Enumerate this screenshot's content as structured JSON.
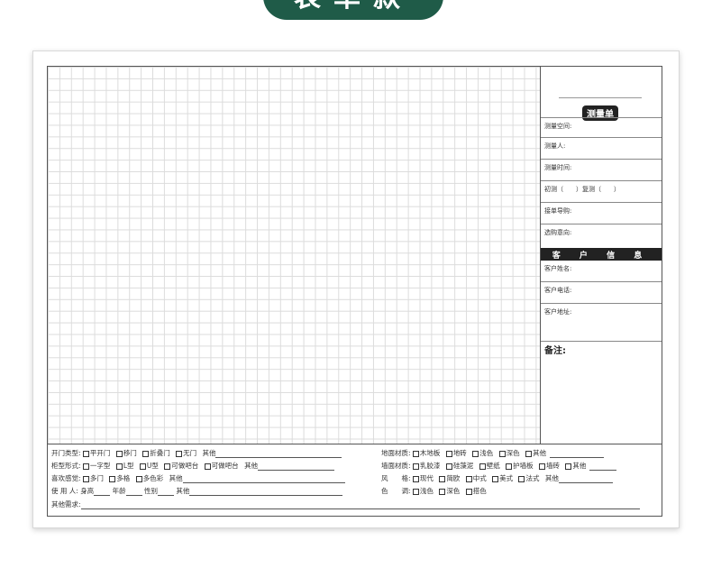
{
  "banner": {
    "title": "表单款"
  },
  "panel": {
    "title": "测量单",
    "rows": [
      "测量空间:",
      "测量人:",
      "测量时间:",
      "初测（　　）复测（　　）",
      "接单导购:",
      "选购意向:"
    ],
    "customer_header": "客 户 信 息",
    "customer_rows": [
      "客户姓名:",
      "客户电话:",
      "客户地址:"
    ],
    "notes_label": "备注:"
  },
  "bottom": {
    "left": [
      {
        "label": "开门类型:",
        "options": [
          "平开门",
          "移门",
          "折叠门",
          "无门"
        ],
        "other": "其他"
      },
      {
        "label": "柜型形式:",
        "options": [
          "一字型",
          "L型",
          "U型",
          "可做吧台",
          "可做吧台"
        ],
        "other": "其他"
      },
      {
        "label": "喜欢感觉:",
        "options": [
          "多门",
          "多格",
          "多色彩"
        ],
        "other": "其他"
      }
    ],
    "user_line": {
      "label": "使 用 人:",
      "height": "身高",
      "age": "年龄",
      "gender": "性别",
      "other": "其他"
    },
    "right": [
      {
        "label": "地面材质:",
        "options": [
          "木地板",
          "地砖",
          "浅色",
          "深色",
          "其他"
        ]
      },
      {
        "label": "墙面材质:",
        "options": [
          "乳胶漆",
          "硅藻泥",
          "壁纸",
          "护墙板",
          "墙砖",
          "其他"
        ]
      },
      {
        "label": "风　　格:",
        "options": [
          "现代",
          "简欧",
          "中式",
          "美式",
          "法式"
        ],
        "other": "其他"
      },
      {
        "label": "色　　调:",
        "options": [
          "浅色",
          "深色",
          "搭色"
        ]
      }
    ],
    "other_needs": "其他需求:"
  }
}
